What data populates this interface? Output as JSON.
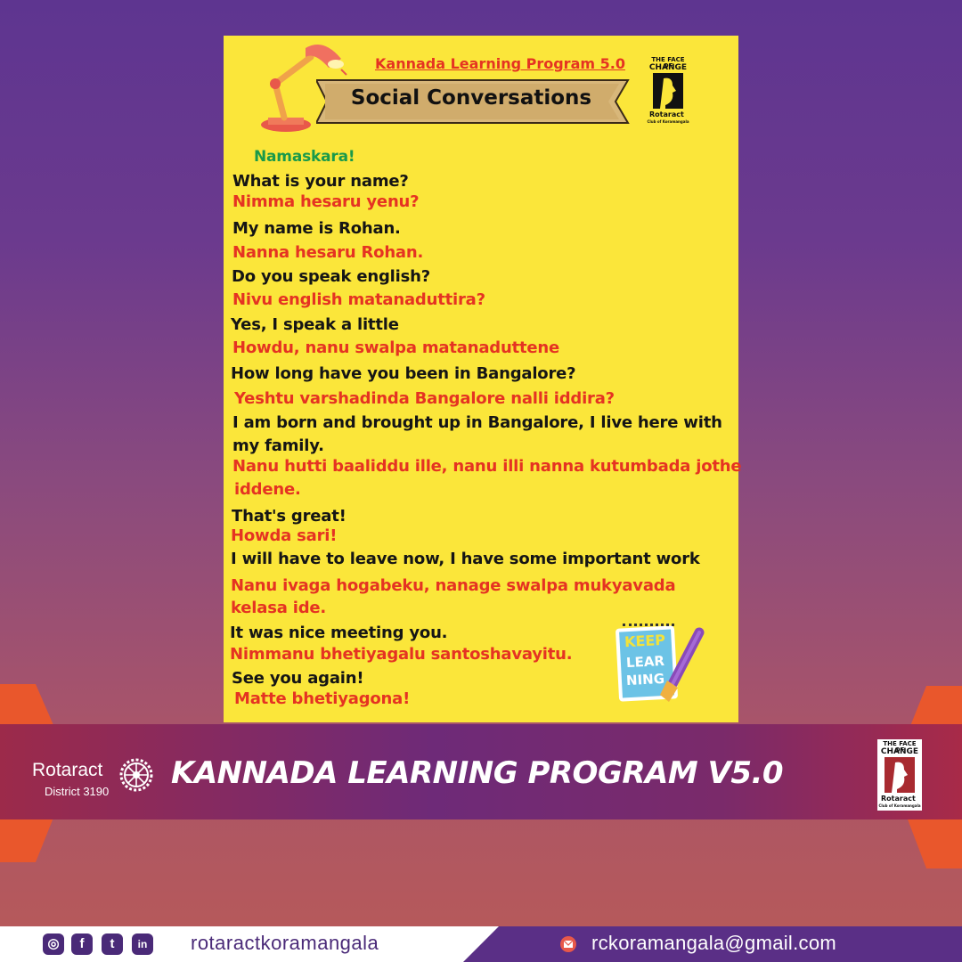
{
  "poster": {
    "program_title": "Kannada Learning Program 5.0",
    "heading": "Social Conversations",
    "greeting": "Namaskara!",
    "lines": [
      {
        "en": "What is your name?",
        "kn": "Nimma hesaru yenu?"
      },
      {
        "en": "My name is Rohan.",
        "kn": "Nanna hesaru Rohan."
      },
      {
        "en": "Do you speak english?",
        "kn": "Nivu english matanaduttira?"
      },
      {
        "en": "Yes, I speak a little",
        "kn": "Howdu, nanu swalpa matanaduttene"
      },
      {
        "en": "How long have you been in Bangalore?",
        "kn": "Yeshtu varshadinda Bangalore nalli iddira?"
      },
      {
        "en_1": "I am born and brought up in Bangalore, I live here with",
        "en_2": "my family.",
        "kn_1": "Nanu hutti baaliddu ille, nanu illi nanna kutumbada jothe",
        "kn_2": "iddene."
      },
      {
        "en": "That's great!",
        "kn": "Howda sari!"
      },
      {
        "en": "I will have to leave now, I have some important work",
        "kn_1": "Nanu ivaga hogabeku, nanage swalpa mukyavada",
        "kn_2": "kelasa ide."
      },
      {
        "en": "It was nice meeting you.",
        "kn": "Nimmanu bhetiyagalu santoshavayitu."
      },
      {
        "en": "See you again!",
        "kn": "Matte bhetiyagona!"
      }
    ],
    "sticker": {
      "line1": "KEEP",
      "line2": "LEAR",
      "line3": "NING"
    }
  },
  "logo": {
    "top": "THE FACE OF",
    "main": "CHANGE",
    "brand": "Rotaract",
    "sub": "Club of Koramangala"
  },
  "banner": {
    "org": "Rotaract",
    "district": "District 3190",
    "title": "KANNADA LEARNING PROGRAM V5.0"
  },
  "footer": {
    "social_icons": [
      "instagram-icon",
      "facebook-icon",
      "twitter-icon",
      "linkedin-icon"
    ],
    "handle": "rotaractkoramangala",
    "email": "rckoramangala@gmail.com"
  },
  "colors": {
    "poster_bg": "#fbe63a",
    "english_text": "#151515",
    "kannada_text": "#e53322",
    "greeting": "#1a9a4a",
    "banner": "#6e2a78",
    "footer_accent": "#5a2f86"
  }
}
